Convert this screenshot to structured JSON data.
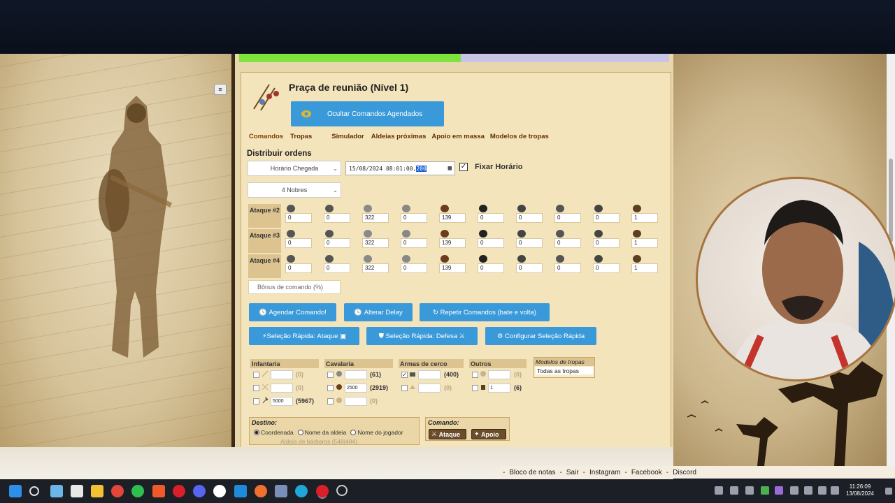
{
  "page": {
    "title": "Praça de reunião (Nível 1)",
    "hide_button": "Ocultar Comandos Agendados"
  },
  "tabs": [
    "Comandos",
    "Tropas",
    "Simulador",
    "Aldeias próximas",
    "Apoio em massa",
    "Modelos de tropas"
  ],
  "distribute": {
    "heading": "Distribuir ordens",
    "mode_select": "Horário Chegada",
    "datetime_prefix": "15/08/2024 08:01:00,",
    "datetime_selected": "200",
    "fix_time_checked": true,
    "fix_time_label": "Fixar Horário",
    "nobles_select": "4 Nobres"
  },
  "attacks": [
    {
      "label": "Ataque #2",
      "values": [
        "0",
        "0",
        "322",
        "0",
        "139",
        "0",
        "0",
        "0",
        "0",
        "1"
      ]
    },
    {
      "label": "Ataque #3",
      "values": [
        "0",
        "0",
        "322",
        "0",
        "139",
        "0",
        "0",
        "0",
        "0",
        "1"
      ]
    },
    {
      "label": "Ataque #4",
      "values": [
        "0",
        "0",
        "322",
        "0",
        "139",
        "0",
        "0",
        "0",
        "0",
        "1"
      ]
    }
  ],
  "bonus_placeholder": "Bônus de comando (%)",
  "buttons": {
    "schedule": "Agendar Comando!",
    "delay": "Alterar Delay",
    "repeat": "Repetir Comandos (bate e volta)",
    "quick_attack": "Seleção Rápida: Ataque",
    "quick_defense": "Seleção Rápida: Defesa",
    "config_quick": "Configurar Seleção Rápida"
  },
  "troop_groups": {
    "infantry": {
      "title": "Infantaria",
      "rows": [
        {
          "checked": false,
          "value": "",
          "count": "(0)"
        },
        {
          "checked": false,
          "value": "",
          "count": "(0)"
        },
        {
          "checked": false,
          "value": "5000",
          "count": "(5967)"
        }
      ]
    },
    "cavalry": {
      "title": "Cavalaria",
      "rows": [
        {
          "checked": false,
          "value": "",
          "count": "(61)"
        },
        {
          "checked": false,
          "value": "2500",
          "count": "(2919)"
        },
        {
          "checked": false,
          "value": "",
          "count": "(0)"
        }
      ]
    },
    "siege": {
      "title": "Armas de cerco",
      "rows": [
        {
          "checked": true,
          "value": "",
          "count": "(400)"
        },
        {
          "checked": false,
          "value": "",
          "count": "(0)"
        }
      ]
    },
    "others": {
      "title": "Outros",
      "rows": [
        {
          "checked": false,
          "value": "",
          "count": "(0)"
        },
        {
          "checked": false,
          "value": "1",
          "count": "(6)"
        }
      ]
    }
  },
  "troop_models": {
    "title": "Modelos de tropas",
    "selected": "Todas as tropas"
  },
  "destination": {
    "title": "Destino:",
    "options": [
      "Coordenada",
      "Nome da aldeia",
      "Nome do jogador"
    ],
    "selected": 0,
    "partial_row": "Aldeia de bárbaros (548|484)"
  },
  "command": {
    "title": "Comando:",
    "attack": "Ataque",
    "support": "Apoio"
  },
  "footer_links": [
    "Bloco de notas",
    "Sair",
    "Instagram",
    "Facebook",
    "Discord"
  ],
  "taskbar": {
    "time": "11:26:09",
    "date": "13/08/2024"
  }
}
